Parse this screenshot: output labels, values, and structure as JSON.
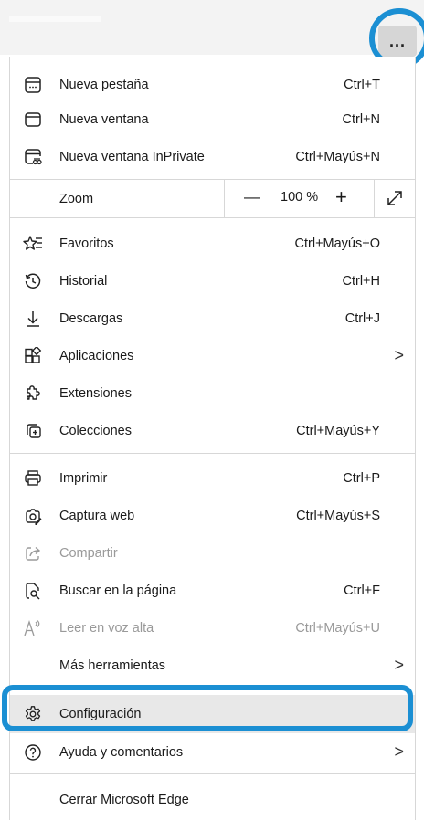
{
  "toolbar": {
    "more_label": "..."
  },
  "menu": {
    "items": [
      {
        "label": "Nueva pestaña",
        "shortcut": "Ctrl+T",
        "icon": "new-tab-icon"
      },
      {
        "label": "Nueva ventana",
        "shortcut": "Ctrl+N",
        "icon": "new-window-icon"
      },
      {
        "label": "Nueva ventana InPrivate",
        "shortcut": "Ctrl+Mayús+N",
        "icon": "inprivate-window-icon"
      },
      {
        "label": "Zoom",
        "value": "100 %",
        "decrease": "—",
        "increase": "+",
        "icon": "fullscreen-icon"
      },
      {
        "label": "Favoritos",
        "shortcut": "Ctrl+Mayús+O",
        "icon": "favorites-icon"
      },
      {
        "label": "Historial",
        "shortcut": "Ctrl+H",
        "icon": "history-icon"
      },
      {
        "label": "Descargas",
        "shortcut": "Ctrl+J",
        "icon": "download-icon"
      },
      {
        "label": "Aplicaciones",
        "shortcut": "",
        "icon": "apps-icon",
        "submenu": true
      },
      {
        "label": "Extensiones",
        "shortcut": "",
        "icon": "extensions-icon"
      },
      {
        "label": "Colecciones",
        "shortcut": "Ctrl+Mayús+Y",
        "icon": "collections-icon"
      },
      {
        "label": "Imprimir",
        "shortcut": "Ctrl+P",
        "icon": "print-icon"
      },
      {
        "label": "Captura web",
        "shortcut": "Ctrl+Mayús+S",
        "icon": "web-capture-icon"
      },
      {
        "label": "Compartir",
        "shortcut": "",
        "icon": "share-icon",
        "disabled": true
      },
      {
        "label": "Buscar en la página",
        "shortcut": "Ctrl+F",
        "icon": "find-icon"
      },
      {
        "label": "Leer en voz alta",
        "shortcut": "Ctrl+Mayús+U",
        "icon": "read-aloud-icon",
        "disabled": true
      },
      {
        "label": "Más herramientas",
        "shortcut": "",
        "submenu": true
      },
      {
        "label": "Configuración",
        "shortcut": "",
        "icon": "settings-icon",
        "selected": true
      },
      {
        "label": "Ayuda y comentarios",
        "shortcut": "",
        "icon": "help-icon",
        "submenu": true
      },
      {
        "label": "Cerrar Microsoft Edge",
        "shortcut": ""
      }
    ],
    "submenu_chevron": ">"
  },
  "colors": {
    "highlight": "#1b8fd3",
    "selected_bg": "#e8e8e8",
    "disabled_text": "#9a9a9a"
  }
}
